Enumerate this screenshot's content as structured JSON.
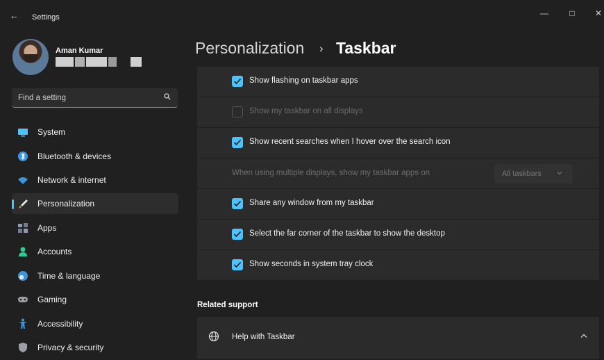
{
  "window": {
    "title": "Settings",
    "back_glyph": "←",
    "controls": [
      "—",
      "□",
      "✕"
    ]
  },
  "profile": {
    "name": "Aman Kumar"
  },
  "search": {
    "placeholder": "Find a setting"
  },
  "nav": {
    "items": [
      {
        "label": "System",
        "icon": "monitor-icon",
        "color": "#4cc2ff"
      },
      {
        "label": "Bluetooth & devices",
        "icon": "bluetooth-icon",
        "color": "#3a96dd"
      },
      {
        "label": "Network & internet",
        "icon": "wifi-icon",
        "color": "#3a96dd"
      },
      {
        "label": "Personalization",
        "icon": "brush-icon",
        "color": "#f0a05a",
        "active": true
      },
      {
        "label": "Apps",
        "icon": "apps-icon",
        "color": "#8e9aaf"
      },
      {
        "label": "Accounts",
        "icon": "person-icon",
        "color": "#2ecc8f"
      },
      {
        "label": "Time & language",
        "icon": "globe-clock-icon",
        "color": "#3a96dd"
      },
      {
        "label": "Gaming",
        "icon": "gamepad-icon",
        "color": "#9aa0a6"
      },
      {
        "label": "Accessibility",
        "icon": "accessibility-icon",
        "color": "#3a96dd"
      },
      {
        "label": "Privacy & security",
        "icon": "shield-icon",
        "color": "#9aa0a6"
      }
    ]
  },
  "breadcrumb": {
    "parent": "Personalization",
    "separator": "›",
    "current": "Taskbar"
  },
  "settings": {
    "rows": [
      {
        "label": "Show flashing on taskbar apps",
        "checked": true,
        "enabled": true
      },
      {
        "label": "Show my taskbar on all displays",
        "checked": false,
        "enabled": false
      },
      {
        "label": "Show recent searches when I hover over the search icon",
        "checked": true,
        "enabled": true
      },
      {
        "label": "When using multiple displays, show my taskbar apps on",
        "dropdown": "All taskbars",
        "enabled": false
      },
      {
        "label": "Share any window from my taskbar",
        "checked": true,
        "enabled": true
      },
      {
        "label": "Select the far corner of the taskbar to show the desktop",
        "checked": true,
        "enabled": true
      },
      {
        "label": "Show seconds in system tray clock",
        "checked": true,
        "enabled": true
      }
    ]
  },
  "related": {
    "heading": "Related support",
    "help_label": "Help with Taskbar"
  }
}
